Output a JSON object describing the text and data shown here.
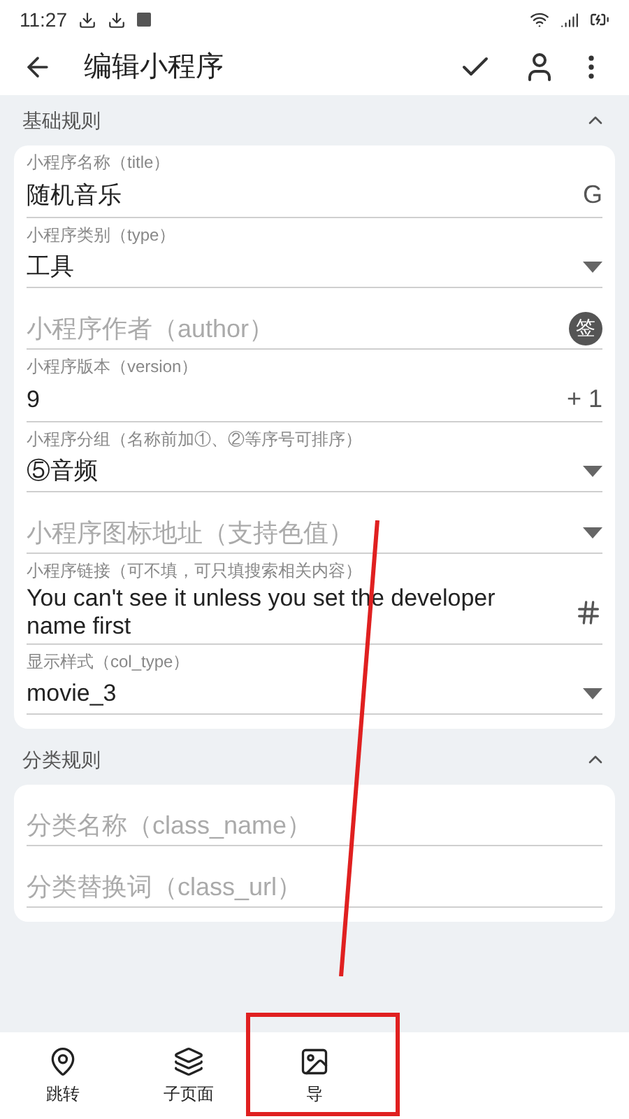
{
  "status_bar": {
    "time": "11:27"
  },
  "app_bar": {
    "title": "编辑小程序"
  },
  "sections": [
    {
      "title": "基础规则",
      "expanded": true,
      "fields": [
        {
          "label": "小程序名称（title）",
          "value": "随机音乐",
          "trailing": {
            "kind": "text",
            "text": "G"
          }
        },
        {
          "label": "小程序类别（type）",
          "value": "工具",
          "trailing": {
            "kind": "dropdown"
          }
        },
        {
          "placeholder": "小程序作者（author）",
          "trailing": {
            "kind": "badge",
            "text": "签"
          }
        },
        {
          "label": "小程序版本（version）",
          "value": "9",
          "trailing": {
            "kind": "text",
            "text": "+ 1"
          }
        },
        {
          "label": "小程序分组（名称前加①、②等序号可排序）",
          "value": "⑤音频",
          "trailing": {
            "kind": "dropdown"
          }
        },
        {
          "placeholder": "小程序图标地址（支持色值）",
          "trailing": {
            "kind": "dropdown"
          }
        },
        {
          "label": "小程序链接（可不填，可只填搜索相关内容）",
          "value": "You can't see it unless you set the developer name first",
          "trailing": {
            "kind": "hash"
          }
        },
        {
          "label": "显示样式（col_type）",
          "value": "movie_3",
          "trailing": {
            "kind": "dropdown"
          }
        }
      ]
    },
    {
      "title": "分类规则",
      "expanded": true,
      "fields": [
        {
          "placeholder": "分类名称（class_name）"
        },
        {
          "placeholder": "分类替换词（class_url）"
        }
      ]
    }
  ],
  "bottom_nav": [
    {
      "label": "跳转",
      "kind": "pin"
    },
    {
      "label": "子页面",
      "kind": "layers"
    },
    {
      "label": "导",
      "kind": "frame"
    }
  ]
}
